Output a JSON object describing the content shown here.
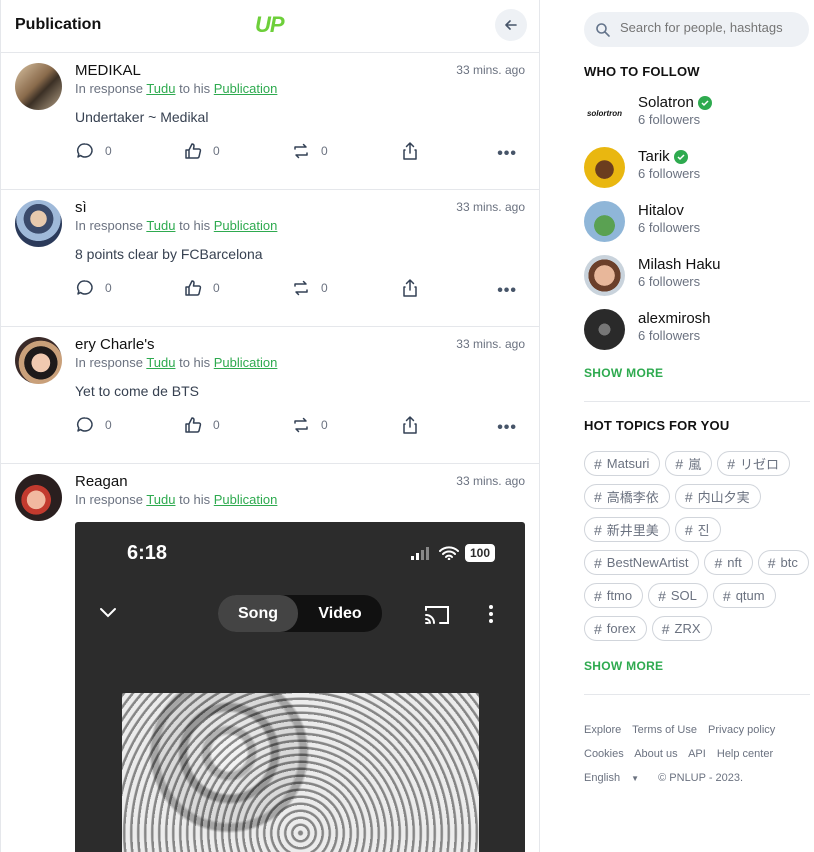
{
  "header": {
    "title": "Publication",
    "logo": "UP",
    "back_icon": "arrow-left-icon"
  },
  "posts": [
    {
      "name": "MEDIKAL",
      "time": "33 mins. ago",
      "resp_prefix": "In response ",
      "resp_user": "Tudu",
      "resp_mid": " to his ",
      "resp_link": "Publication",
      "text": "Undertaker ~ Medikal",
      "comments": "0",
      "likes": "0",
      "reposts": "0"
    },
    {
      "name": "sì",
      "time": "33 mins. ago",
      "resp_prefix": "In response ",
      "resp_user": "Tudu",
      "resp_mid": " to his ",
      "resp_link": "Publication",
      "text": "8 points clear by FCBarcelona",
      "comments": "0",
      "likes": "0",
      "reposts": "0"
    },
    {
      "name": "ery Charle's",
      "time": "33 mins. ago",
      "resp_prefix": "In response ",
      "resp_user": "Tudu",
      "resp_mid": " to his ",
      "resp_link": "Publication",
      "text": "Yet to come de BTS",
      "comments": "0",
      "likes": "0",
      "reposts": "0"
    },
    {
      "name": "Reagan",
      "time": "33 mins. ago",
      "resp_prefix": "In response ",
      "resp_user": "Tudu",
      "resp_mid": " to his ",
      "resp_link": "Publication",
      "media": {
        "clock": "6:18",
        "battery": "100",
        "tab_song": "Song",
        "tab_video": "Video"
      }
    }
  ],
  "search": {
    "placeholder": "Search for people, hashtags"
  },
  "who_to_follow": {
    "heading": "WHO TO FOLLOW",
    "items": [
      {
        "name": "Solatron",
        "followers": "6 followers",
        "verified": true,
        "avatar_text": "solortron"
      },
      {
        "name": "Tarik",
        "followers": "6 followers",
        "verified": true
      },
      {
        "name": "Hitalov",
        "followers": "6 followers",
        "verified": false
      },
      {
        "name": "Milash Haku",
        "followers": "6 followers",
        "verified": false
      },
      {
        "name": "alexmirosh",
        "followers": "6 followers",
        "verified": false
      }
    ],
    "show_more": "SHOW MORE"
  },
  "hot_topics": {
    "heading": "HOT TOPICS FOR YOU",
    "tags": [
      "Matsuri",
      "嵐",
      "リゼロ",
      "高橋李依",
      "内山夕実",
      "新井里美",
      "진",
      "BestNewArtist",
      "nft",
      "btc",
      "ftmo",
      "SOL",
      "qtum",
      "forex",
      "ZRX"
    ],
    "show_more": "SHOW MORE"
  },
  "footer": {
    "links": [
      "Explore",
      "Terms of Use",
      "Privacy policy",
      "Cookies",
      "About us",
      "API",
      "Help center"
    ],
    "language": "English",
    "copyright": "© PNLUP - 2023."
  },
  "colors": {
    "accent": "#2eaa4f",
    "logo": "#6dcf3a"
  }
}
